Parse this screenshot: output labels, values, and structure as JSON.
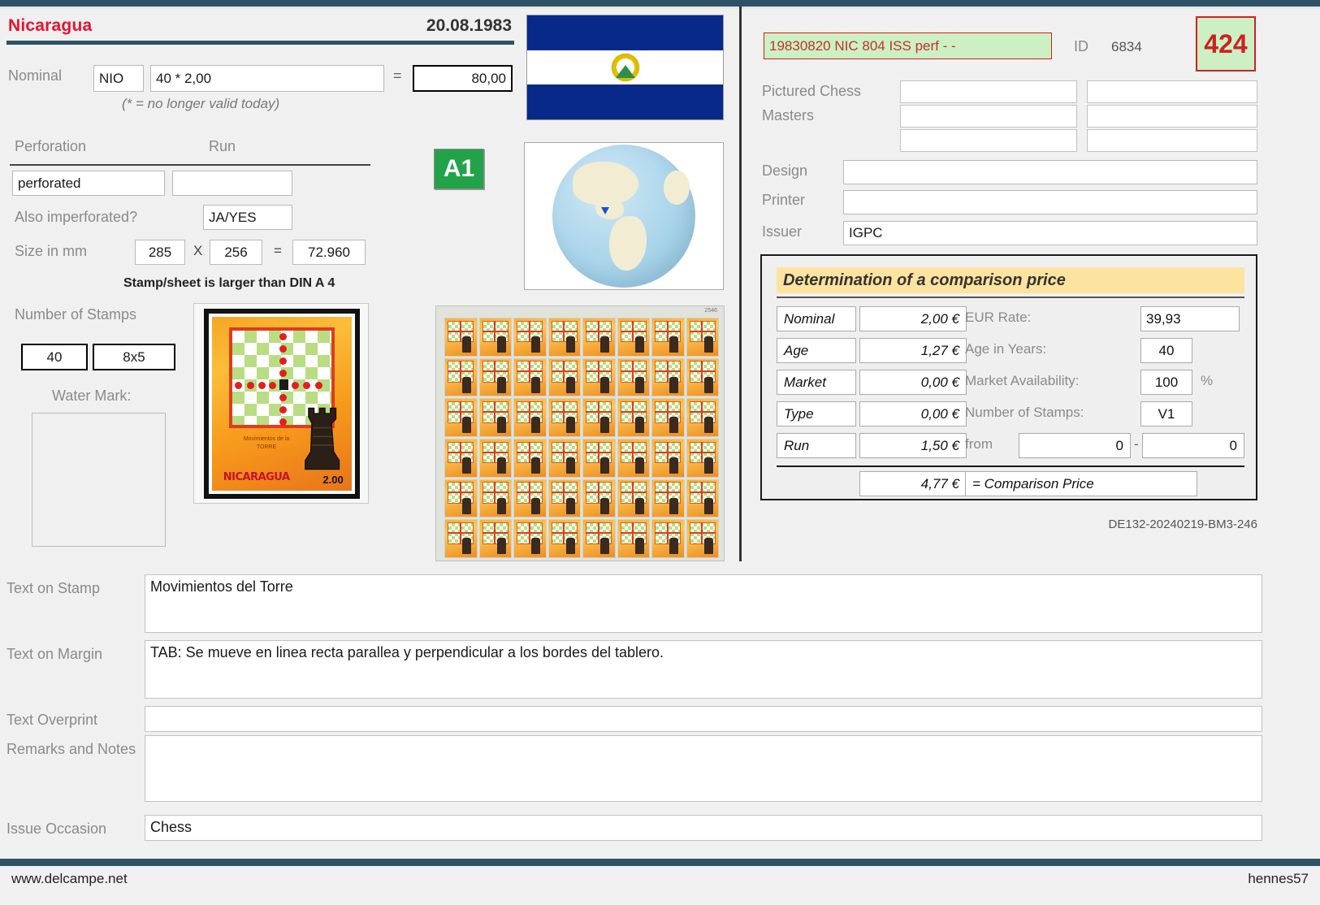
{
  "header": {
    "country": "Nicaragua",
    "date": "20.08.1983"
  },
  "nominal": {
    "label": "Nominal",
    "currency": "NIO",
    "calculation": "40 * 2,00",
    "equals_sign": "=",
    "total": "80,00",
    "note": "(* = no longer valid today)"
  },
  "perforation": {
    "label": "Perforation",
    "run_label": "Run",
    "value": "perforated",
    "run_value": "",
    "also_imperforated_label": "Also imperforated?",
    "also_imperforated_value": "JA/YES"
  },
  "size": {
    "label": "Size in mm",
    "width": "285",
    "x_sign": "X",
    "height": "256",
    "equals_sign": "=",
    "area": "72.960",
    "note": "Stamp/sheet is larger than DIN A 4"
  },
  "stamps": {
    "label": "Number of Stamps",
    "count": "40",
    "grid": "8x5",
    "watermark_label": "Water Mark:",
    "watermark_value": ""
  },
  "badges": {
    "a1": "A1",
    "count": "424"
  },
  "record": {
    "ref_code": "19830820 NIC 804 ISS perf - -",
    "id_label": "ID",
    "id_value": "6834"
  },
  "meta": {
    "pictured_label_line1": "Pictured Chess",
    "pictured_label_line2": "Masters",
    "pictured_values": [
      "",
      "",
      "",
      "",
      "",
      ""
    ],
    "design_label": "Design",
    "design_value": "",
    "printer_label": "Printer",
    "printer_value": "",
    "issuer_label": "Issuer",
    "issuer_value": "IGPC"
  },
  "comparison": {
    "title": "Determination of a comparison price",
    "rows": [
      {
        "name": "Nominal",
        "value": "2,00 €",
        "label": "EUR Rate:",
        "input": "39,93"
      },
      {
        "name": "Age",
        "value": "1,27 €",
        "label": "Age in Years:",
        "input": "40"
      },
      {
        "name": "Market",
        "value": "0,00 €",
        "label": "Market Availability:",
        "input": "100"
      },
      {
        "name": "Type",
        "value": "0,00 €",
        "label": "Number of Stamps:",
        "input": "V1"
      },
      {
        "name": "Run",
        "value": "1,50 €",
        "label": "from",
        "input": "0"
      }
    ],
    "percent_sign": "%",
    "range_dash": "-",
    "range_to": "0",
    "result_value": "4,77 €",
    "result_label": "= Comparison Price"
  },
  "archive_code": "DE132-20240219-BM3-246",
  "bottom": {
    "text_on_stamp_label": "Text on Stamp",
    "text_on_stamp_value": "Movimientos del Torre",
    "text_on_margin_label": "Text on Margin",
    "text_on_margin_value": "TAB: Se mueve en linea recta parallea y perpendicular a los bordes del tablero.",
    "text_overprint_label": "Text Overprint",
    "text_overprint_value": "",
    "remarks_label": "Remarks and Notes",
    "remarks_value": "",
    "issue_occasion_label": "Issue Occasion",
    "issue_occasion_value": "Chess"
  },
  "watermarks": {
    "left": "www.delcampe.net",
    "right": "hennes57"
  },
  "stamp_image": {
    "caption_line1": "Movimientos de la",
    "caption_line2": "TORRE",
    "country": "NICARAGUA",
    "denomination": "2.00"
  },
  "colors": {
    "accent_bar": "#2e5266",
    "country_red": "#e8112d",
    "badge_green": "#22a34a",
    "highlight_green": "#ccf0c4",
    "highlight_red": "#d02020",
    "title_yellow": "#fde3a0"
  }
}
